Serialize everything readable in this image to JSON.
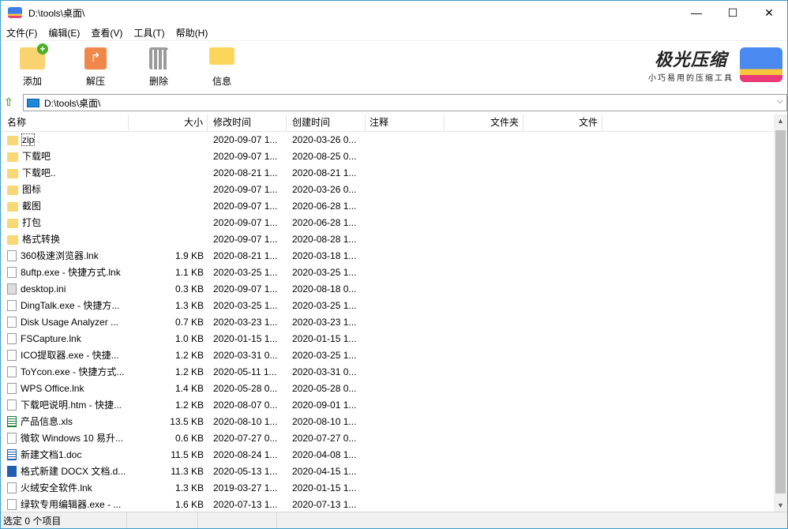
{
  "window": {
    "title": "D:\\tools\\桌面\\",
    "minimize": "—",
    "maximize": "☐",
    "close": "✕"
  },
  "menu": [
    "文件(F)",
    "编辑(E)",
    "查看(V)",
    "工具(T)",
    "帮助(H)"
  ],
  "toolbar": {
    "add": "添加",
    "extract": "解压",
    "delete": "删除",
    "info": "信息"
  },
  "logo": {
    "name": "极光压缩",
    "slogan": "小巧易用的压缩工具"
  },
  "address": {
    "path": "D:\\tools\\桌面\\"
  },
  "columns": [
    "名称",
    "大小",
    "修改时间",
    "创建时间",
    "注释",
    "文件夹",
    "文件"
  ],
  "files": [
    {
      "name": "zip",
      "size": "",
      "modified": "2020-09-07 1...",
      "created": "2020-03-26 0...",
      "type": "folder"
    },
    {
      "name": "下载吧",
      "size": "",
      "modified": "2020-09-07 1...",
      "created": "2020-08-25 0...",
      "type": "folder"
    },
    {
      "name": "下载吧..",
      "size": "",
      "modified": "2020-08-21 1...",
      "created": "2020-08-21 1...",
      "type": "folder"
    },
    {
      "name": "图标",
      "size": "",
      "modified": "2020-09-07 1...",
      "created": "2020-03-26 0...",
      "type": "folder"
    },
    {
      "name": "截图",
      "size": "",
      "modified": "2020-09-07 1...",
      "created": "2020-06-28 1...",
      "type": "folder"
    },
    {
      "name": "打包",
      "size": "",
      "modified": "2020-09-07 1...",
      "created": "2020-06-28 1...",
      "type": "folder"
    },
    {
      "name": "格式转换",
      "size": "",
      "modified": "2020-09-07 1...",
      "created": "2020-08-28 1...",
      "type": "folder"
    },
    {
      "name": "360极速浏览器.lnk",
      "size": "1.9 KB",
      "modified": "2020-08-21 1...",
      "created": "2020-03-18 1...",
      "type": "file"
    },
    {
      "name": "8uftp.exe - 快捷方式.lnk",
      "size": "1.1 KB",
      "modified": "2020-03-25 1...",
      "created": "2020-03-25 1...",
      "type": "file"
    },
    {
      "name": "desktop.ini",
      "size": "0.3 KB",
      "modified": "2020-09-07 1...",
      "created": "2020-08-18 0...",
      "type": "ini"
    },
    {
      "name": "DingTalk.exe - 快捷方...",
      "size": "1.3 KB",
      "modified": "2020-03-25 1...",
      "created": "2020-03-25 1...",
      "type": "file"
    },
    {
      "name": "Disk Usage Analyzer ...",
      "size": "0.7 KB",
      "modified": "2020-03-23 1...",
      "created": "2020-03-23 1...",
      "type": "file"
    },
    {
      "name": "FSCapture.lnk",
      "size": "1.0 KB",
      "modified": "2020-01-15 1...",
      "created": "2020-01-15 1...",
      "type": "file"
    },
    {
      "name": "ICO提取器.exe - 快捷...",
      "size": "1.2 KB",
      "modified": "2020-03-31 0...",
      "created": "2020-03-25 1...",
      "type": "file"
    },
    {
      "name": "ToYcon.exe - 快捷方式...",
      "size": "1.2 KB",
      "modified": "2020-05-11 1...",
      "created": "2020-03-31 0...",
      "type": "file"
    },
    {
      "name": "WPS Office.lnk",
      "size": "1.4 KB",
      "modified": "2020-05-28 0...",
      "created": "2020-05-28 0...",
      "type": "file"
    },
    {
      "name": "下载吧说明.htm - 快捷...",
      "size": "1.2 KB",
      "modified": "2020-08-07 0...",
      "created": "2020-09-01 1...",
      "type": "file"
    },
    {
      "name": "产品信息.xls",
      "size": "13.5 KB",
      "modified": "2020-08-10 1...",
      "created": "2020-08-10 1...",
      "type": "xls"
    },
    {
      "name": "微软 Windows 10 易升...",
      "size": "0.6 KB",
      "modified": "2020-07-27 0...",
      "created": "2020-07-27 0...",
      "type": "file"
    },
    {
      "name": "新建文档1.doc",
      "size": "11.5 KB",
      "modified": "2020-08-24 1...",
      "created": "2020-04-08 1...",
      "type": "doc"
    },
    {
      "name": "格式新建 DOCX 文档.d...",
      "size": "11.3 KB",
      "modified": "2020-05-13 1...",
      "created": "2020-04-15 1...",
      "type": "docx"
    },
    {
      "name": "火绒安全软件.lnk",
      "size": "1.3 KB",
      "modified": "2019-03-27 1...",
      "created": "2020-01-15 1...",
      "type": "file"
    },
    {
      "name": "绿软专用编辑器.exe - ...",
      "size": "1.6 KB",
      "modified": "2020-07-13 1...",
      "created": "2020-07-13 1...",
      "type": "file"
    }
  ],
  "status": {
    "selected": "选定 0 个项目"
  }
}
